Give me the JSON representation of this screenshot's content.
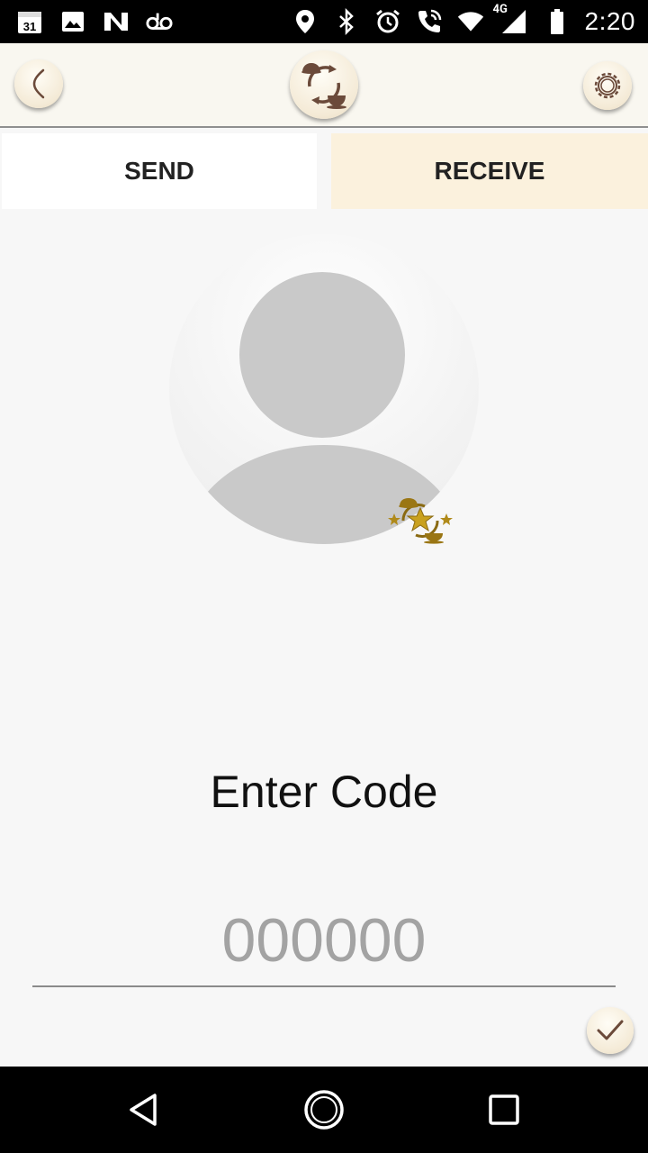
{
  "status_bar": {
    "time": "2:20",
    "network": "4G",
    "calendar_day": "31",
    "left_icons": [
      "calendar-icon",
      "image-icon",
      "n-app-icon",
      "voicemail-icon"
    ],
    "right_icons": [
      "location-icon",
      "bluetooth-icon",
      "alarm-icon",
      "phone-call-icon",
      "wifi-icon",
      "cell-signal-icon",
      "battery-icon"
    ]
  },
  "app_bar": {
    "back_icon": "chevron-left-icon",
    "logo_icon": "cup-exchange-logo-icon",
    "settings_icon": "gear-icon"
  },
  "tabs": [
    {
      "label": "SEND",
      "selected": false
    },
    {
      "label": "RECEIVE",
      "selected": true
    }
  ],
  "avatar": {
    "icon": "user-avatar-placeholder",
    "badge_icon": "cup-stars-badge-icon"
  },
  "code_entry": {
    "label": "Enter Code",
    "placeholder": "000000",
    "value": ""
  },
  "confirm_icon": "checkmark-icon",
  "nav_bar": {
    "icons": [
      "back-triangle-icon",
      "home-circle-icon",
      "recents-square-icon"
    ]
  },
  "colors": {
    "accent_brown": "#6b4a3a",
    "tab_selected_bg": "#fbf1dd",
    "appbar_bg": "#f9f7f0",
    "gold": "#b08a1a"
  }
}
